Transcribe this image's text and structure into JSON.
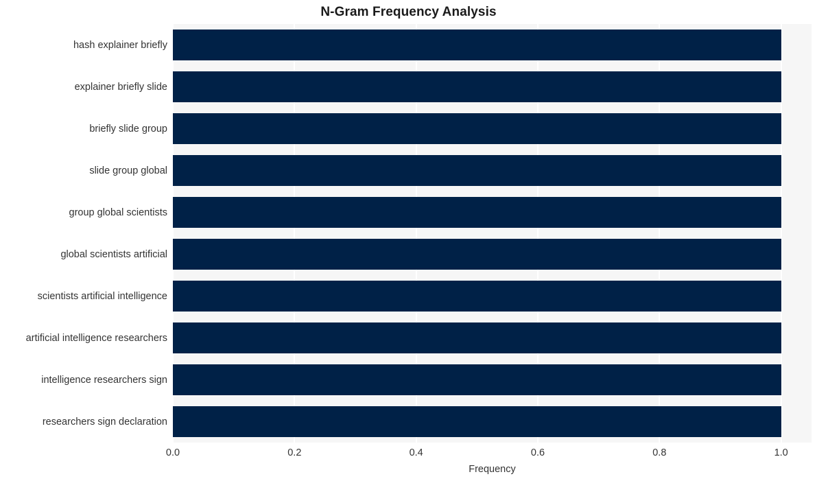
{
  "chart_data": {
    "type": "bar",
    "orientation": "horizontal",
    "title": "N-Gram Frequency Analysis",
    "xlabel": "Frequency",
    "ylabel": "",
    "categories": [
      "hash explainer briefly",
      "explainer briefly slide",
      "briefly slide group",
      "slide group global",
      "group global scientists",
      "global scientists artificial",
      "scientists artificial intelligence",
      "artificial intelligence researchers",
      "intelligence researchers sign",
      "researchers sign declaration"
    ],
    "values": [
      1.0,
      1.0,
      1.0,
      1.0,
      1.0,
      1.0,
      1.0,
      1.0,
      1.0,
      1.0
    ],
    "xlim": [
      0.0,
      1.05
    ],
    "xticks": [
      0.0,
      0.2,
      0.4,
      0.6,
      0.8,
      1.0
    ],
    "xticklabels": [
      "0.0",
      "0.2",
      "0.4",
      "0.6",
      "0.8",
      "1.0"
    ],
    "grid": true,
    "grid_axis": "x",
    "legend": null,
    "bar_color": "#002147",
    "plot_background": "#f6f6f6",
    "figure_background": "#ffffff",
    "gridline_color": "#ffffff"
  }
}
